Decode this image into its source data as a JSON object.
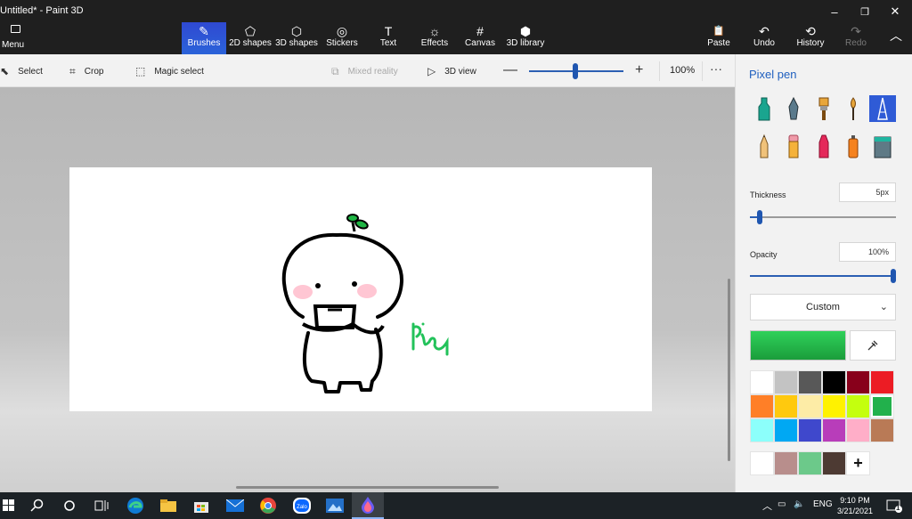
{
  "window": {
    "title": "Untitled* - Paint 3D",
    "min": "–",
    "max": "❐",
    "close": "✕"
  },
  "ribbon": {
    "menu_label": "Menu",
    "tools": [
      {
        "label": "Brushes",
        "glyph": "✎"
      },
      {
        "label": "2D shapes",
        "glyph": "⬠"
      },
      {
        "label": "3D shapes",
        "glyph": "⬡"
      },
      {
        "label": "Stickers",
        "glyph": "◎"
      },
      {
        "label": "Text",
        "glyph": "T"
      },
      {
        "label": "Effects",
        "glyph": "☼"
      },
      {
        "label": "Canvas",
        "glyph": "#"
      },
      {
        "label": "3D library",
        "glyph": "⬢"
      }
    ],
    "right": [
      {
        "label": "Paste",
        "glyph": "📋"
      },
      {
        "label": "Undo",
        "glyph": "↶"
      },
      {
        "label": "History",
        "glyph": "⟲"
      },
      {
        "label": "Redo",
        "glyph": "↷"
      }
    ],
    "collapse": "︿"
  },
  "subbar": {
    "select": "Select",
    "crop": "Crop",
    "magic_select": "Magic select",
    "mixed_reality": "Mixed reality",
    "view_3d": "3D view",
    "zoom_minus": "—",
    "zoom_plus": "+",
    "zoom_value": "100%",
    "zoom_level": 0.5,
    "more": "···"
  },
  "panel": {
    "title": "Pixel pen",
    "brushes": [
      "marker",
      "calligraphy-pen",
      "oil-brush",
      "watercolor",
      "pixel-pen",
      "pencil",
      "eraser",
      "crayon",
      "spray-can",
      "fill"
    ],
    "thickness_label": "Thickness",
    "thickness_value": "5px",
    "thickness_level": 0.05,
    "opacity_label": "Opacity",
    "opacity_value": "100%",
    "opacity_level": 1.0,
    "color_mode": "Custom",
    "current_color": "#22b14c",
    "palette": [
      "#ffffff",
      "#c3c3c3",
      "#585858",
      "#000000",
      "#88001b",
      "#ec1c24",
      "#ff7f27",
      "#ffc90e",
      "#fdeca6",
      "#fff200",
      "#c4ff0e",
      "#22b14c",
      "#8cfffb",
      "#00a8f3",
      "#3f48cc",
      "#b83dba",
      "#ffaec8",
      "#b97a56"
    ],
    "recent_colors": [
      "#ffffff",
      "#b88e8c",
      "#6cc98a",
      "#4d3a33"
    ],
    "add_color": "+"
  },
  "taskbar": {
    "apps": [
      "start",
      "search",
      "cortana",
      "task-view",
      "edge",
      "file-explorer",
      "store",
      "mail",
      "chrome",
      "zalo",
      "photos",
      "paint-3d"
    ],
    "tray_lang": "ENG",
    "time": "9:10 PM",
    "date": "3/21/2021",
    "notification_count": "1"
  }
}
